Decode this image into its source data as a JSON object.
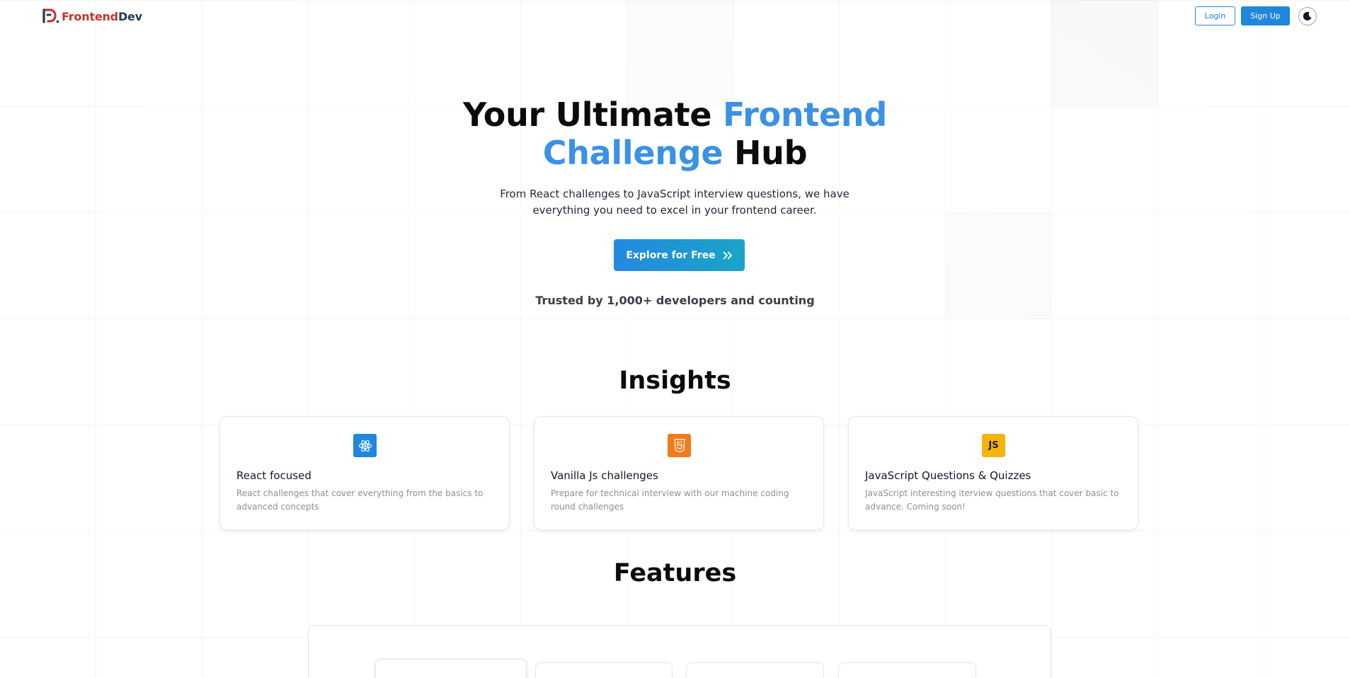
{
  "header": {
    "logo": {
      "icon": "fd-logo-icon",
      "text_part1": "Frontend",
      "text_part2": "Dev"
    },
    "login_label": "Login",
    "signup_label": "Sign Up",
    "theme_toggle_icon": "moon-icon"
  },
  "hero": {
    "title_part1": "Your Ultimate ",
    "title_highlight1": "Frontend",
    "title_highlight2": "Challenge",
    "title_part2": " Hub",
    "subtitle": "From React challenges to JavaScript interview questions, we have everything you need to excel in your frontend career.",
    "cta_label": "Explore for Free",
    "cta_icon": "double-chevron-right-icon",
    "trusted_text": "Trusted by 1,000+ developers and counting"
  },
  "insights": {
    "title": "Insights",
    "cards": [
      {
        "icon": "react-icon",
        "icon_color": "#1f87dc",
        "title": "React focused",
        "description": "React challenges that cover everything from the basics to advanced concepts"
      },
      {
        "icon": "html5-icon",
        "icon_color": "#f07b1c",
        "title": "Vanilla Js challenges",
        "description": "Prepare for technical interview with our machine coding round challenges"
      },
      {
        "icon": "js-icon",
        "icon_label": "JS",
        "icon_color": "#f5b30c",
        "title": "JavaScript Questions & Quizzes",
        "description": "JavaScript interesting iterview questions that cover basic to advance. Coming soon!"
      }
    ]
  },
  "features": {
    "title": "Features"
  },
  "colors": {
    "accent": "#1f87dc",
    "highlight": "#3b92e4",
    "logo_red": "#c0392b",
    "logo_navy": "#1f3b57"
  }
}
